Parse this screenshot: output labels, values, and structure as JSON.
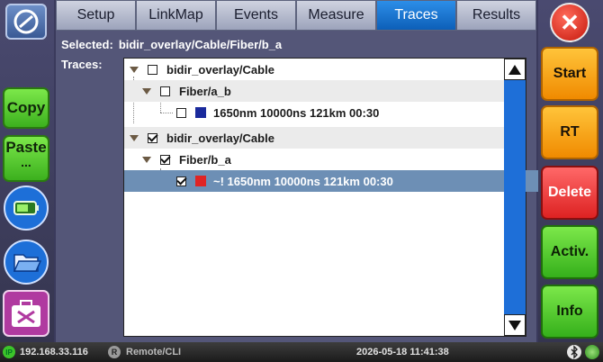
{
  "tabs": [
    {
      "label": "Setup",
      "active": false
    },
    {
      "label": "LinkMap",
      "active": false
    },
    {
      "label": "Events",
      "active": false
    },
    {
      "label": "Measure",
      "active": false
    },
    {
      "label": "Traces",
      "active": true
    },
    {
      "label": "Results",
      "active": false
    }
  ],
  "left": {
    "copy_label": "Copy",
    "paste_label": "Paste",
    "paste_sub": "..."
  },
  "selected": {
    "label": "Selected:",
    "value": "bidir_overlay/Cable/Fiber/b_a"
  },
  "traces_label": "Traces:",
  "tree": [
    {
      "text": "bidir_overlay/Cable",
      "checked": false
    },
    {
      "text": "Fiber/a_b",
      "checked": false
    },
    {
      "text": "1650nm 10000ns 121km 00:30",
      "checked": false,
      "color": "#1a2a9c"
    },
    {
      "text": "bidir_overlay/Cable",
      "checked": true
    },
    {
      "text": "Fiber/b_a",
      "checked": true
    },
    {
      "text": "~! 1650nm 10000ns 121km 00:30",
      "checked": true,
      "color": "#e02424"
    }
  ],
  "right": {
    "start": "Start",
    "rt": "RT",
    "delete": "Delete",
    "activ": "Activ.",
    "info": "Info"
  },
  "status": {
    "ip_badge": "IP",
    "ip": "192.168.33.116",
    "remote_badge": "R",
    "remote": "Remote/CLI",
    "datetime": "2026-05-18 11:41:38"
  },
  "icons": [
    "app-logo-icon",
    "battery-icon",
    "folder-icon",
    "toolbox-icon",
    "close-icon",
    "bluetooth-icon",
    "globe-icon"
  ]
}
